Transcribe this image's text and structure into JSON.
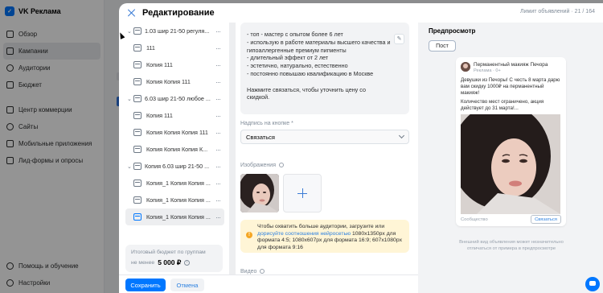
{
  "app": {
    "logo_text": "VK Реклама",
    "nav": [
      {
        "label": "Обзор",
        "icon": "home-icon"
      },
      {
        "label": "Кампании",
        "icon": "campaigns-icon",
        "active": true
      },
      {
        "label": "Аудитории",
        "icon": "audiences-icon"
      },
      {
        "label": "Бюджет",
        "icon": "budget-icon"
      }
    ],
    "nav2": [
      {
        "label": "Центр коммерции",
        "icon": "commerce-icon"
      },
      {
        "label": "Сайты",
        "icon": "sites-icon"
      },
      {
        "label": "Мобильные приложения",
        "icon": "apps-icon"
      },
      {
        "label": "Лид-формы и опросы",
        "icon": "leadforms-icon"
      }
    ],
    "nav_bottom": [
      {
        "label": "Помощь и обучение",
        "icon": "help-icon"
      },
      {
        "label": "Настройки",
        "icon": "settings-icon"
      }
    ]
  },
  "modal": {
    "title": "Редактирование",
    "limit": "Лимит объявлений · 21 / 164"
  },
  "list": {
    "rows": [
      {
        "label": "1.03 шир 21-50 регуля...",
        "type": "group"
      },
      {
        "label": "111",
        "type": "ad"
      },
      {
        "label": "Копия 111",
        "type": "ad"
      },
      {
        "label": "Копия Копия 111",
        "type": "ad"
      },
      {
        "label": "6.03 шир 21-50 любое ...",
        "type": "group"
      },
      {
        "label": "Копия 111",
        "type": "ad"
      },
      {
        "label": "Копия Копия Копия 111",
        "type": "ad"
      },
      {
        "label": "Копия Копия Копия К...",
        "type": "ad"
      },
      {
        "label": "Копия 6.03 шир 21-50 ...",
        "type": "group"
      },
      {
        "label": "Копия_1 Копия Копия ...",
        "type": "ad"
      },
      {
        "label": "Копия_1 Копия Копия ...",
        "type": "ad"
      },
      {
        "label": "Копия_1 Копия Копия ...",
        "type": "ad",
        "selected": true
      }
    ],
    "budget_line1": "Итоговый бюджет по группам",
    "budget_prefix": "не менее",
    "budget_value": "5 000 ₽"
  },
  "form": {
    "description_lines": [
      "- топ - мастер с опытом более 6 лет",
      "- использую в работе материалы высшего качества и",
      "гипоаллергенные премиум пигменты",
      "- длительный эффект от 2 лет",
      "- эстетично, натурально, естественно",
      "- постоянно повышаю квалификацию в Москве",
      "",
      "Нажмите связаться, чтобы уточнить цену со",
      "скидкой."
    ],
    "button_label_title": "Надпись на кнопке *",
    "button_label_value": "Связаться",
    "images_title": "Изображения",
    "warning_text_1": "Чтобы охватить больше аудитории, загрузите или",
    "warning_link": "дорисуйте соотношения нейросетью",
    "warning_text_2": "1080x1350px для формата 4:5;  1080x607px для формата 16:9; 607x1080px для формата 9:16",
    "video_title": "Видео"
  },
  "preview": {
    "title": "Предпросмотр",
    "tab": "Пост",
    "page_name": "Перманентный макияж Печора",
    "page_sub": "Реклама · 0+",
    "text_1": "Девушки из Печоры! С честь 8 марта дарю вам скидку 1000₽ на перманентный макияж!",
    "text_2": "Количество мест ограничено, акция действует до 31 марта!...",
    "footer_label": "Сообщество",
    "cta": "Связаться",
    "note": "Внешний вид объявления может незначительно отличаться от примера в предпросмотре"
  },
  "footer": {
    "save": "Сохранить",
    "cancel": "Отмена"
  },
  "colors": {
    "accent": "#0077ff",
    "warning_bg": "#fff5d6"
  }
}
